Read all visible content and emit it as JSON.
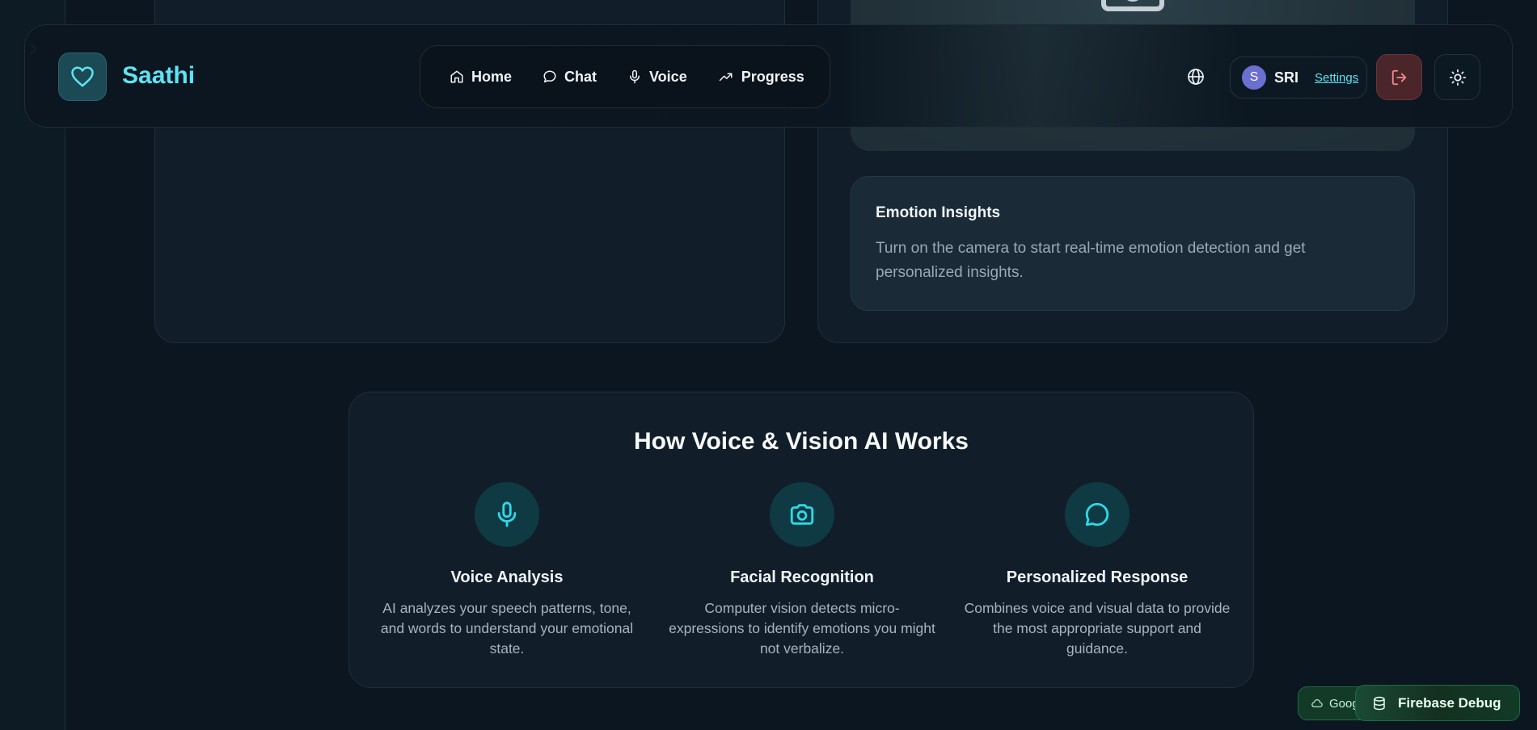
{
  "app": {
    "brand": "Saathi"
  },
  "nav": {
    "items": [
      {
        "label": "Home",
        "icon": "home-icon"
      },
      {
        "label": "Chat",
        "icon": "chat-icon"
      },
      {
        "label": "Voice",
        "icon": "mic-icon"
      },
      {
        "label": "Progress",
        "icon": "trending-up-icon"
      }
    ]
  },
  "user": {
    "initial": "S",
    "name": "SRI",
    "settings_label": "Settings"
  },
  "insights": {
    "title": "Emotion Insights",
    "body": "Turn on the camera to start real-time emotion detection and get personalized insights."
  },
  "how": {
    "title": "How Voice & Vision AI Works",
    "features": [
      {
        "title": "Voice Analysis",
        "body": "AI analyzes your speech patterns, tone, and words to understand your emotional state.",
        "icon": "mic-icon"
      },
      {
        "title": "Facial Recognition",
        "body": "Computer vision detects micro-expressions to identify emotions you might not verbalize.",
        "icon": "camera-icon"
      },
      {
        "title": "Personalized Response",
        "body": "Combines voice and visual data to provide the most appropriate support and guidance.",
        "icon": "message-circle-icon"
      }
    ]
  },
  "badges": {
    "google": "Goog",
    "firebase": "Firebase Debug"
  },
  "colors": {
    "accent": "#5ee3f2",
    "background": "#0b1620",
    "card": "#111e2a",
    "logout": "#4a262b",
    "success": "#1f6b42"
  }
}
